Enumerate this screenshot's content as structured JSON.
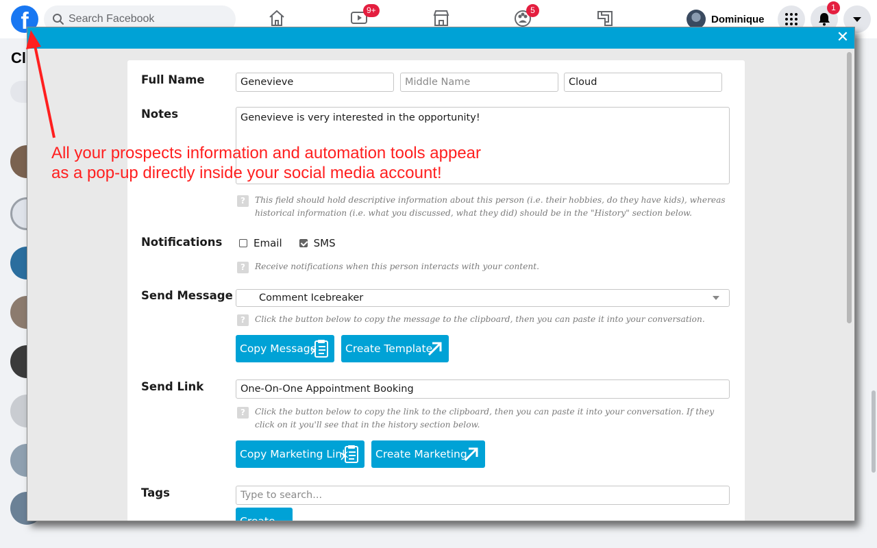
{
  "facebook": {
    "logo": "f",
    "search": {
      "placeholder": "Search Facebook"
    },
    "nav": [
      {
        "icon": "home-icon"
      },
      {
        "icon": "watch-icon",
        "badge": "9+"
      },
      {
        "icon": "marketplace-icon"
      },
      {
        "icon": "groups-icon",
        "badge": "5"
      },
      {
        "icon": "gaming-icon"
      }
    ],
    "user": {
      "name": "Dominique"
    },
    "menu_icon": "apps-grid-icon",
    "notifications": {
      "badge": "1"
    },
    "account_icon": "chevron-down-icon",
    "sidebar_heading_partial": "Cl"
  },
  "modal": {
    "close_label": "✕",
    "accent_color": "#00a2d6",
    "full_name": {
      "label": "Full Name",
      "first": "Genevieve",
      "middle_placeholder": "Middle Name",
      "last": "Cloud"
    },
    "notes": {
      "label": "Notes",
      "value": "Genevieve is very interested in the opportunity!",
      "hint": "This field should hold descriptive information about this person (i.e. their hobbies, do they have kids), whereas historical information (i.e. what you discussed, what they did) should be in the \"History\" section below."
    },
    "notifications": {
      "label": "Notifications",
      "email_label": "Email",
      "email_checked": false,
      "sms_label": "SMS",
      "sms_checked": true,
      "hint": "Receive notifications when this person interacts with your content."
    },
    "send_message": {
      "label": "Send Message",
      "selected": "Comment Icebreaker",
      "hint": "Click the button below to copy the message to the clipboard, then you can paste it into your conversation.",
      "copy_button": "Copy Message",
      "create_button": "Create Template"
    },
    "send_link": {
      "label": "Send Link",
      "value": "One-On-One Appointment Booking",
      "hint": "Click the button below to copy the link to the clipboard, then you can paste it into your conversation. If they click on it you'll see that in the history section below.",
      "copy_button": "Copy Marketing Link",
      "create_button": "Create Marketing"
    },
    "tags": {
      "label": "Tags",
      "placeholder": "Type to search...",
      "create_button": "Create Tag"
    }
  },
  "annotation": {
    "text": "All your prospects information and automation tools appear\nas a pop-up directly inside your social media account!",
    "color": "#ff1f1f"
  }
}
